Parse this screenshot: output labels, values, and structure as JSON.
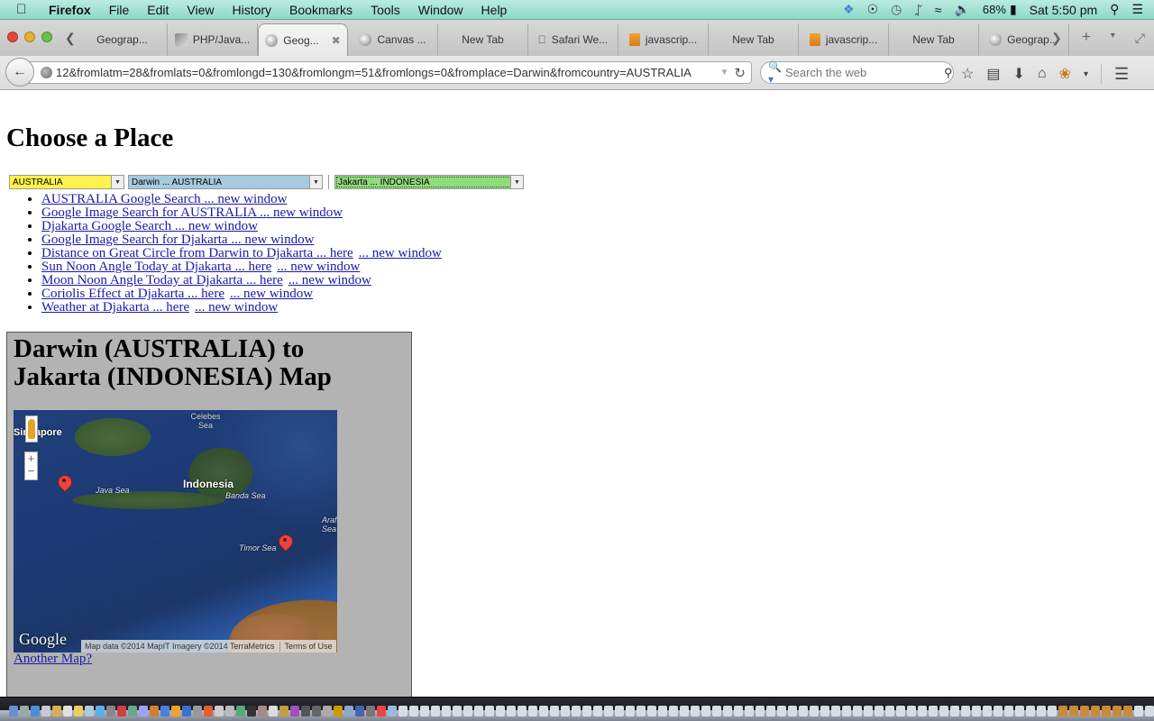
{
  "menubar": {
    "app_name": "Firefox",
    "items": [
      "File",
      "Edit",
      "View",
      "History",
      "Bookmarks",
      "Tools",
      "Window",
      "Help"
    ],
    "status": {
      "battery": "68%",
      "clock": "Sat 5:50 pm"
    }
  },
  "tabs": [
    {
      "label": "Geograp...",
      "icon": "globe-icon",
      "active": false
    },
    {
      "label": "PHP/Java...",
      "icon": "image-icon",
      "active": false
    },
    {
      "label": "Geog...",
      "icon": "globe-icon",
      "active": true
    },
    {
      "label": "Canvas ...",
      "icon": "globe-icon",
      "active": false
    },
    {
      "label": "New Tab",
      "icon": "",
      "active": false
    },
    {
      "label": "Safari We...",
      "icon": "apple-icon",
      "active": false
    },
    {
      "label": "javascrip...",
      "icon": "stackoverflow-icon",
      "active": false
    },
    {
      "label": "New Tab",
      "icon": "",
      "active": false
    },
    {
      "label": "javascrip...",
      "icon": "stackoverflow-icon",
      "active": false
    },
    {
      "label": "New Tab",
      "icon": "",
      "active": false
    },
    {
      "label": "Geograp...",
      "icon": "globe-icon",
      "active": false
    }
  ],
  "navbar": {
    "url": "12&fromlatm=28&fromlats=0&fromlongd=130&fromlongm=51&fromlongs=0&fromplace=Darwin&fromcountry=AUSTRALIA",
    "search_placeholder": "Search the web"
  },
  "page": {
    "title": "Choose a Place",
    "selects": {
      "country": "AUSTRALIA",
      "from_place": "Darwin ... AUSTRALIA",
      "to_place": "Jakarta ... INDONESIA"
    },
    "colors": {
      "country_select": "#fff24a",
      "from_select": "#a6cbe0",
      "to_select": "#8fdc7a",
      "link": "#1a1aa6",
      "map_panel": "#b3b3b3"
    },
    "links": [
      {
        "primary": "AUSTRALIA Google Search ... new window"
      },
      {
        "primary": "Google Image Search for AUSTRALIA ... new window"
      },
      {
        "primary": "Djakarta Google Search ... new window"
      },
      {
        "primary": "Google Image Search for Djakarta ... new window"
      },
      {
        "primary": "Distance on Great Circle from Darwin to Djakarta ... here",
        "secondary": "... new window"
      },
      {
        "primary": "Sun Noon Angle Today at Djakarta ... here",
        "secondary": "... new window"
      },
      {
        "primary": "Moon Noon Angle Today at Djakarta ... here",
        "secondary": "... new window"
      },
      {
        "primary": "Coriolis Effect at Djakarta ... here",
        "secondary": "... new window"
      },
      {
        "primary": "Weather at Djakarta ... here",
        "secondary": "... new window"
      }
    ],
    "map_section": {
      "heading": "Darwin (AUSTRALIA) to Jakarta (INDONESIA) Map",
      "map_labels": {
        "singapore": "Singapore",
        "celebes_sea": "Celebes Sea",
        "java_sea": "Java Sea",
        "indonesia": "Indonesia",
        "banda_sea": "Banda Sea",
        "arafura_sea": "Arafura Sea",
        "timor_sea": "Timor Sea"
      },
      "zoom_in": "+",
      "zoom_out": "−",
      "google_logo": "Google",
      "attribution": "Map data ©2014 MapIT Imagery ©2014 TerraMetrics",
      "terms": "Terms of Use",
      "another_map": "Another Map?"
    }
  }
}
